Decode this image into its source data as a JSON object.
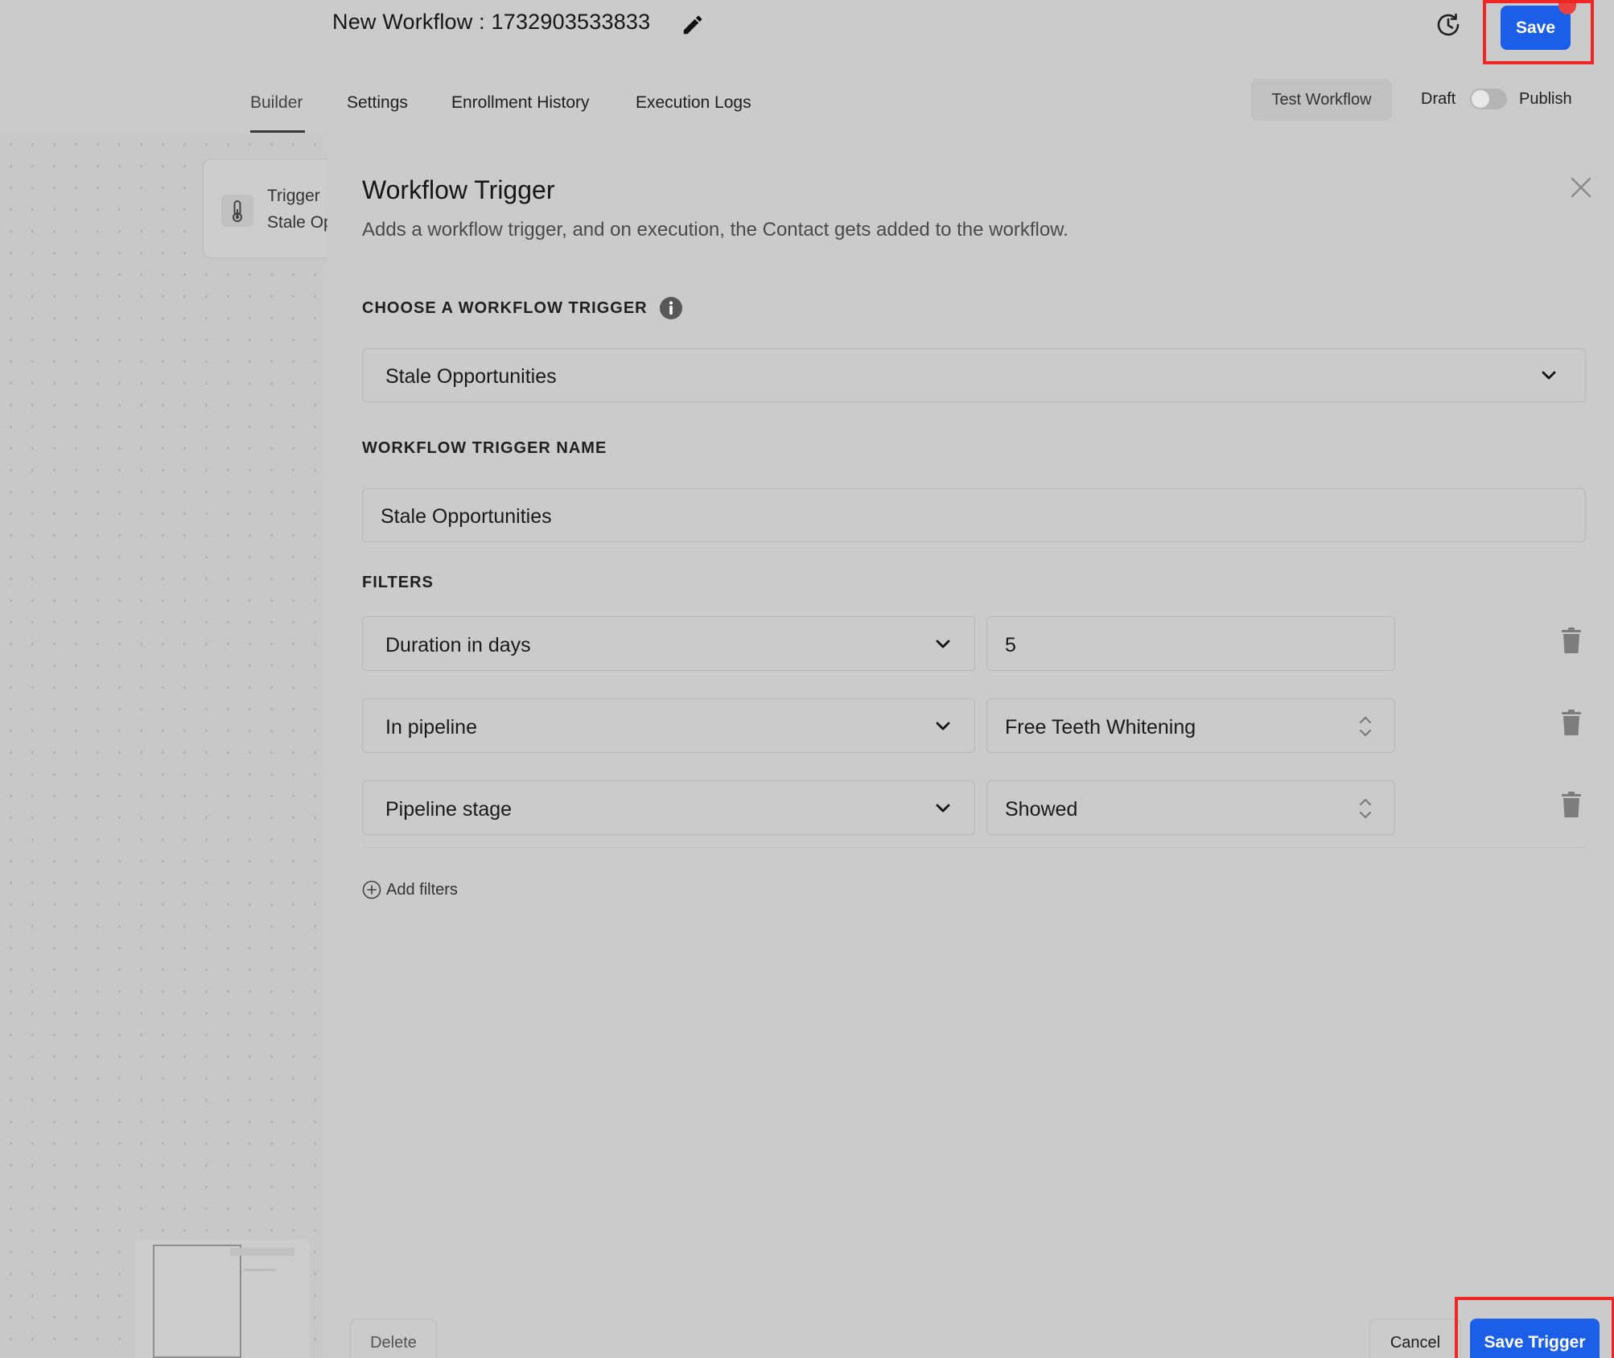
{
  "header": {
    "workflow_title": "New Workflow : 1732903533833",
    "save_label": "Save"
  },
  "tabs": [
    {
      "label": "Builder",
      "active": true
    },
    {
      "label": "Settings",
      "active": false
    },
    {
      "label": "Enrollment History",
      "active": false
    },
    {
      "label": "Execution Logs",
      "active": false
    }
  ],
  "toolbar": {
    "test_workflow_label": "Test Workflow",
    "draft_label": "Draft",
    "publish_label": "Publish",
    "publish_toggle_on": false
  },
  "canvas": {
    "trigger_card": {
      "title": "Trigger",
      "subtitle": "Stale Opportunities"
    }
  },
  "panel": {
    "title": "Workflow Trigger",
    "description": "Adds a workflow trigger, and on execution, the Contact gets added to the workflow.",
    "choose_trigger_label": "CHOOSE A WORKFLOW TRIGGER",
    "selected_trigger": "Stale Opportunities",
    "trigger_name_label": "WORKFLOW TRIGGER NAME",
    "trigger_name_value": "Stale Opportunities",
    "filters_label": "FILTERS",
    "filters": [
      {
        "field": "Duration in days",
        "value": "5",
        "value_type": "text"
      },
      {
        "field": "In pipeline",
        "value": "Free Teeth Whitening",
        "value_type": "select"
      },
      {
        "field": "Pipeline stage",
        "value": "Showed",
        "value_type": "select"
      }
    ],
    "add_filters_label": "Add filters",
    "delete_label": "Delete",
    "cancel_label": "Cancel",
    "save_trigger_label": "Save Trigger"
  },
  "colors": {
    "primary_button": "#1b5ee8",
    "highlight_border": "#ee2626",
    "notification_dot": "#e8413f"
  },
  "icons": [
    "edit-icon",
    "history-icon",
    "thermometer-icon",
    "info-icon",
    "close-icon",
    "chevron-down-icon",
    "sort-icon",
    "trash-icon",
    "plus-circle-icon"
  ]
}
